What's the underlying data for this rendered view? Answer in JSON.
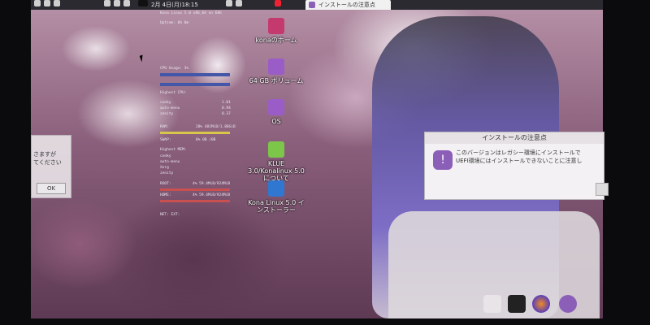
{
  "topbar": {
    "clock": "2月 4日(月)18:15",
    "window_button": "インストールの注意点"
  },
  "conky": {
    "hostname": "Kona Linux 5.0 x86_64 on 686",
    "uptime_label": "Uptime: 0h 0m",
    "cpu_label": "CPU Usage: 3%",
    "highest_cpu": "Highest CPU:",
    "cpu_procs": [
      "conky",
      "auto-menu",
      "zenity"
    ],
    "cpu_vals": [
      "1.01",
      "0.94",
      "0.37"
    ],
    "ram_label": "RAM:",
    "ram_value": "28% 481MiB/1.88GiB",
    "swap_label": "SWAP:",
    "swap_value": "0% 0B /0B",
    "highest_mem": "Highest MEM:",
    "mem_procs": [
      "conky",
      "auto-menu",
      "Xorg",
      "zenity"
    ],
    "root_label": "ROOT:",
    "root_value": "4% 59.4MiB/924MiB",
    "home_label": "HOME:",
    "home_value": "4% 59.4MiB/924MiB",
    "net_label": "NET: EXT:"
  },
  "desktop_icons": [
    {
      "label": "konaのホーム",
      "icon": "home-folder-icon",
      "color": "#c43a6e"
    },
    {
      "label": "64 GB ボリューム",
      "icon": "drive-icon",
      "color": "#9a5dc8"
    },
    {
      "label": "OS",
      "icon": "drive-icon",
      "color": "#9a5dc8"
    },
    {
      "label": "KLUE 3.0/Konalinux 5.0について",
      "icon": "klue-icon",
      "color": "#7cc74a"
    },
    {
      "label": "Kona Linux 5.0 インストーラー",
      "icon": "debian-installer-icon",
      "color": "#2f77d0"
    }
  ],
  "dialog": {
    "title": "インストールの注意点",
    "message_line1": "このバージョンはレガシー環境にインストールで",
    "message_line2": "UEFI環境にはインストールできないことに注意し",
    "icon": "alert-bubble-icon"
  },
  "left_dialog": {
    "line1": "さますが",
    "line2": "てください",
    "ok_label": "OK"
  },
  "dock": [
    {
      "name": "file-manager-icon"
    },
    {
      "name": "terminal-icon"
    },
    {
      "name": "firefox-icon"
    },
    {
      "name": "alert-bubble-icon"
    }
  ],
  "colors": {
    "accent": "#8b5fb8",
    "cpu_bar": "#4456a8",
    "ram_bar": "#d6c64a",
    "disk_bar": "#c85050"
  }
}
